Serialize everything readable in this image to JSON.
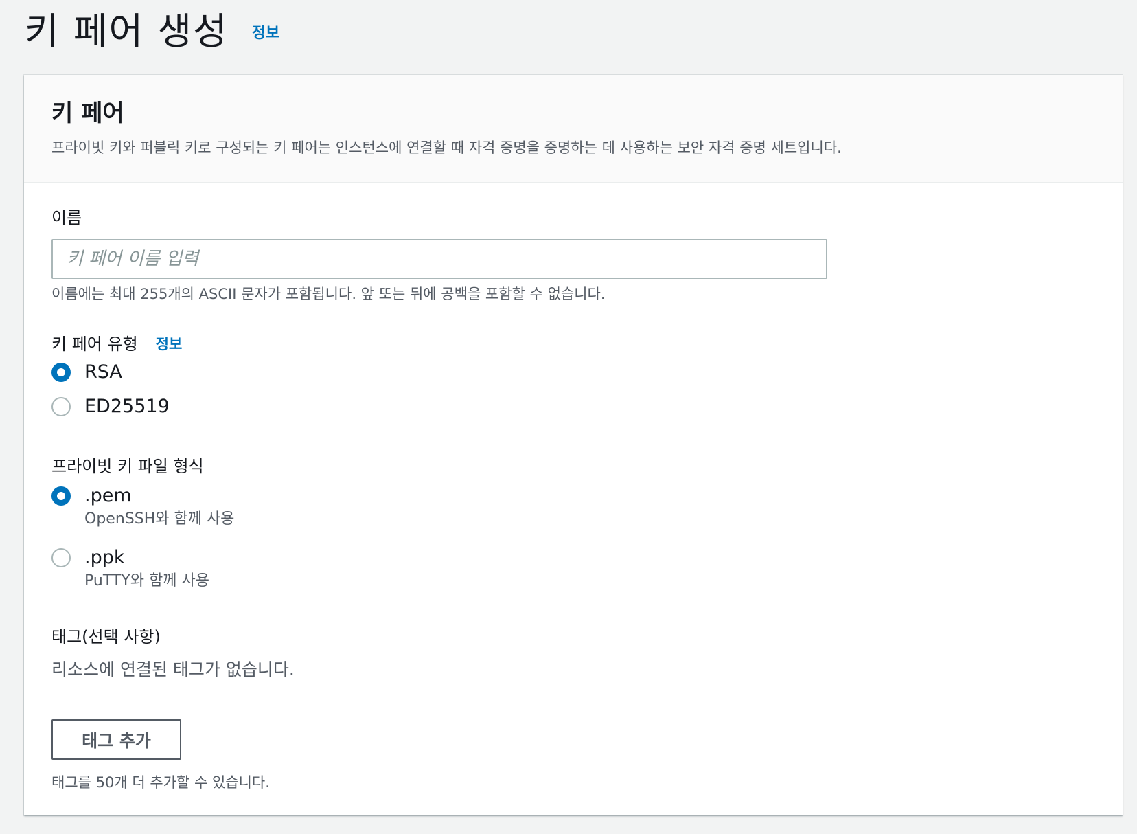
{
  "page": {
    "title": "키 페어 생성",
    "info_link": "정보"
  },
  "panel": {
    "title": "키 페어",
    "description": "프라이빗 키와 퍼블릭 키로 구성되는 키 페어는 인스턴스에 연결할 때 자격 증명을 증명하는 데 사용하는 보안 자격 증명 세트입니다."
  },
  "name_field": {
    "label": "이름",
    "value": "",
    "placeholder": "키 페어 이름 입력",
    "hint": "이름에는 최대 255개의 ASCII 문자가 포함됩니다. 앞 또는 뒤에 공백을 포함할 수 없습니다."
  },
  "key_type": {
    "label": "키 페어 유형",
    "info_link": "정보",
    "options": [
      {
        "label": "RSA",
        "selected": true
      },
      {
        "label": "ED25519",
        "selected": false
      }
    ]
  },
  "file_format": {
    "label": "프라이빗 키 파일 형식",
    "options": [
      {
        "label": ".pem",
        "description": "OpenSSH와 함께 사용",
        "selected": true
      },
      {
        "label": ".ppk",
        "description": "PuTTY와 함께 사용",
        "selected": false
      }
    ]
  },
  "tags": {
    "label": "태그(선택 사항)",
    "empty_message": "리소스에 연결된 태그가 없습니다.",
    "add_button": "태그 추가",
    "limit_hint": "태그를 50개 더 추가할 수 있습니다."
  },
  "colors": {
    "accent": "#0073bb",
    "background": "#f2f3f3",
    "text_primary": "#16191f",
    "text_secondary": "#545b64",
    "border": "#aab7b8"
  }
}
